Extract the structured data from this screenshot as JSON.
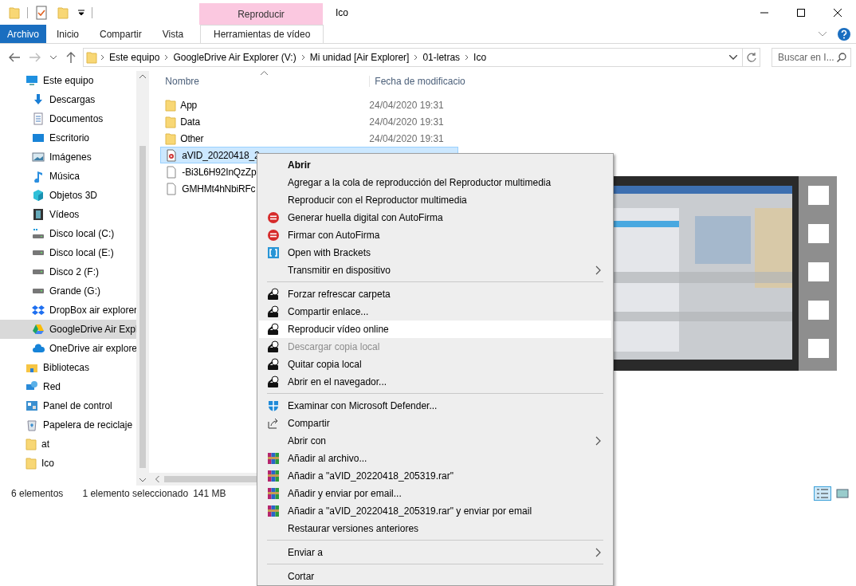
{
  "title": "Ico",
  "contextual_group": "Reproducir",
  "ribbon_tabs": [
    {
      "label": "Archivo",
      "kind": "file"
    },
    {
      "label": "Inicio",
      "kind": "normal"
    },
    {
      "label": "Compartir",
      "kind": "normal"
    },
    {
      "label": "Vista",
      "kind": "normal"
    },
    {
      "label": "Herramientas de vídeo",
      "kind": "contextual"
    }
  ],
  "breadcrumb": [
    "Este equipo",
    "GoogleDrive Air Explorer (V:)",
    "Mi unidad [Air Explorer]",
    "01-letras",
    "Ico"
  ],
  "search": {
    "placeholder": "Buscar en I..."
  },
  "nav": [
    {
      "label": "Este equipo",
      "selected": false,
      "children": [
        {
          "label": "Descargas",
          "selected": false
        },
        {
          "label": "Documentos",
          "selected": false
        },
        {
          "label": "Escritorio",
          "selected": false
        },
        {
          "label": "Imágenes",
          "selected": false
        },
        {
          "label": "Música",
          "selected": false
        },
        {
          "label": "Objetos 3D",
          "selected": false
        },
        {
          "label": "Vídeos",
          "selected": false
        },
        {
          "label": "Disco local (C:)",
          "selected": false
        },
        {
          "label": "Disco local (E:)",
          "selected": false
        },
        {
          "label": "Disco 2 (F:)",
          "selected": false
        },
        {
          "label": "Grande (G:)",
          "selected": false
        },
        {
          "label": "DropBox air explorer",
          "selected": false
        },
        {
          "label": "GoogleDrive Air Expl",
          "selected": true
        },
        {
          "label": "OneDrive air explore",
          "selected": false
        }
      ]
    },
    {
      "label": "Bibliotecas",
      "selected": false
    },
    {
      "label": "Red",
      "selected": false
    },
    {
      "label": "Panel de control",
      "selected": false
    },
    {
      "label": "Papelera de reciclaje",
      "selected": false
    },
    {
      "label": "at",
      "selected": false
    },
    {
      "label": "Ico",
      "selected": false
    }
  ],
  "columns": [
    "Nombre",
    "Fecha de modificacio"
  ],
  "files": [
    {
      "name": "App",
      "date": "24/04/2020 19:31",
      "kind": "folder",
      "selected": false
    },
    {
      "name": "Data",
      "date": "24/04/2020 19:31",
      "kind": "folder",
      "selected": false
    },
    {
      "name": "Other",
      "date": "24/04/2020 19:31",
      "kind": "folder",
      "selected": false
    },
    {
      "name": "aVID_20220418_2",
      "kind": "video",
      "selected": true
    },
    {
      "name": "-Bi3L6H92InQzZp",
      "kind": "file",
      "selected": false
    },
    {
      "name": "GMHMt4hNbiRFc",
      "kind": "file",
      "selected": false
    }
  ],
  "preview": {
    "kind": "picture"
  },
  "status_bar": {
    "count": "6 elementos",
    "selection": "1 elemento seleccionado",
    "size": "141 MB"
  },
  "views": [
    {
      "kind": "details",
      "selected": true
    },
    {
      "kind": "thumbnails",
      "selected": false
    }
  ],
  "menu": [
    {
      "kind": "item",
      "label": "Abrir",
      "default": true,
      "disabled": false,
      "highlighted": false,
      "submenu": false
    },
    {
      "kind": "item",
      "label": "Agregar a la cola de reproducción del Reproductor multimedia",
      "default": false,
      "disabled": false,
      "highlighted": false,
      "submenu": false
    },
    {
      "kind": "item",
      "label": "Reproducir con el Reproductor multimedia",
      "default": false,
      "disabled": false,
      "highlighted": false,
      "submenu": false
    },
    {
      "kind": "item",
      "label": "Generar huella digital con AutoFirma",
      "default": false,
      "disabled": false,
      "highlighted": false,
      "submenu": false
    },
    {
      "kind": "item",
      "label": "Firmar con AutoFirma",
      "default": false,
      "disabled": false,
      "highlighted": false,
      "submenu": false
    },
    {
      "kind": "item",
      "label": "Open with Brackets",
      "default": false,
      "disabled": false,
      "highlighted": false,
      "submenu": false
    },
    {
      "kind": "item",
      "label": "Transmitir en dispositivo",
      "default": false,
      "disabled": false,
      "highlighted": false,
      "submenu": true
    },
    {
      "kind": "separator"
    },
    {
      "kind": "item",
      "label": "Forzar refrescar carpeta",
      "default": false,
      "disabled": false,
      "highlighted": false,
      "submenu": false
    },
    {
      "kind": "item",
      "label": "Compartir enlace...",
      "default": false,
      "disabled": false,
      "highlighted": false,
      "submenu": false
    },
    {
      "kind": "item",
      "label": "Reproducir vídeo online",
      "default": false,
      "disabled": false,
      "highlighted": true,
      "submenu": false
    },
    {
      "kind": "item",
      "label": "Descargar copia local",
      "default": false,
      "disabled": true,
      "highlighted": false,
      "submenu": false
    },
    {
      "kind": "item",
      "label": "Quitar copia local",
      "default": false,
      "disabled": false,
      "highlighted": false,
      "submenu": false
    },
    {
      "kind": "item",
      "label": "Abrir en el navegador...",
      "default": false,
      "disabled": false,
      "highlighted": false,
      "submenu": false
    },
    {
      "kind": "separator"
    },
    {
      "kind": "item",
      "label": "Examinar con Microsoft Defender...",
      "default": false,
      "disabled": false,
      "highlighted": false,
      "submenu": false
    },
    {
      "kind": "item",
      "label": "Compartir",
      "default": false,
      "disabled": false,
      "highlighted": false,
      "submenu": false
    },
    {
      "kind": "item",
      "label": "Abrir con",
      "default": false,
      "disabled": false,
      "highlighted": false,
      "submenu": true
    },
    {
      "kind": "item",
      "label": "Añadir al archivo...",
      "default": false,
      "disabled": false,
      "highlighted": false,
      "submenu": false
    },
    {
      "kind": "item",
      "label": "Añadir a \"aVID_20220418_205319.rar\"",
      "default": false,
      "disabled": false,
      "highlighted": false,
      "submenu": false
    },
    {
      "kind": "item",
      "label": "Añadir y enviar por email...",
      "default": false,
      "disabled": false,
      "highlighted": false,
      "submenu": false
    },
    {
      "kind": "item",
      "label": "Añadir a \"aVID_20220418_205319.rar\" y enviar por email",
      "default": false,
      "disabled": false,
      "highlighted": false,
      "submenu": false
    },
    {
      "kind": "item",
      "label": "Restaurar versiones anteriores",
      "default": false,
      "disabled": false,
      "highlighted": false,
      "submenu": false
    },
    {
      "kind": "separator"
    },
    {
      "kind": "item",
      "label": "Enviar a",
      "default": false,
      "disabled": false,
      "highlighted": false,
      "submenu": true
    },
    {
      "kind": "separator"
    },
    {
      "kind": "item",
      "label": "Cortar",
      "default": false,
      "disabled": false,
      "highlighted": false,
      "submenu": false
    }
  ]
}
